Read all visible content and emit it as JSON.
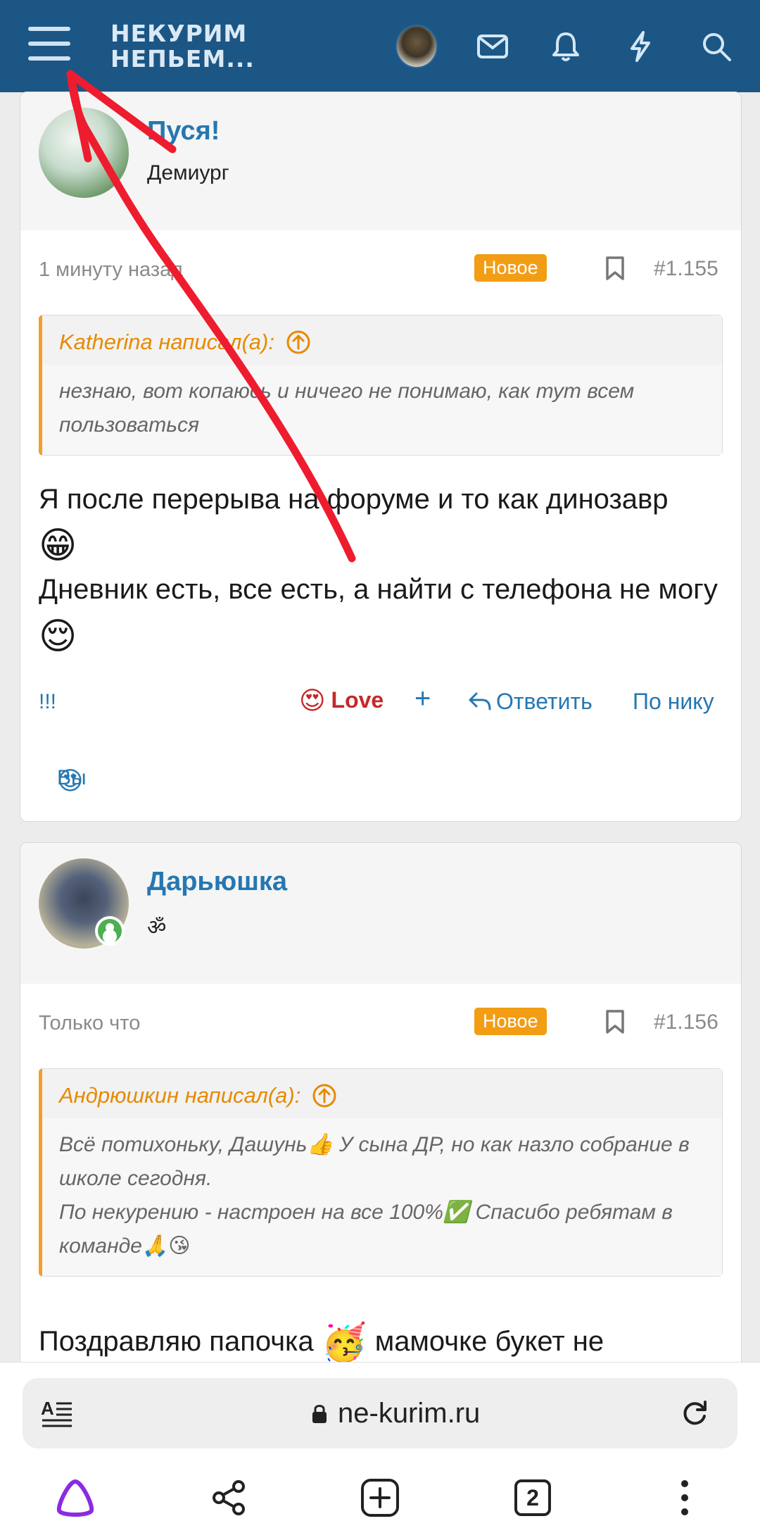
{
  "header": {
    "logo_line1": "НЕКУРИМ",
    "logo_line2": "НЕПЬЕМ...",
    "icons": [
      "menu-icon",
      "avatar",
      "mail-icon",
      "bell-icon",
      "bolt-icon",
      "search-icon"
    ]
  },
  "posts": [
    {
      "author": "Пуся!",
      "title": "Демиург",
      "time": "1 минуту назад",
      "badge": "Новое",
      "number": "#1.155",
      "quote_author": "Katherina написал(а):",
      "quote_text": "незнаю, вот копаюсь и ничего не понимаю, как тут всем пользоваться",
      "message_line1": "Я после перерыва на форуме и то как динозавр",
      "message_line2": "Дневник есть, все есть, а найти с телефона не могу",
      "action_left": "!!!",
      "reaction_label": "Love",
      "reply_label": "Ответить",
      "nick_label": "По нику",
      "reacted_by": "Вы"
    },
    {
      "author": "Дарьюшка",
      "title": "ॐ",
      "time": "Только что",
      "badge": "Новое",
      "number": "#1.156",
      "quote_author": "Андрюшкин написал(а):",
      "quote_line1": "Всё потихоньку, Дашунь👍 У сына ДР, но как назло собрание в школе сегодня.",
      "quote_line2": "По некурению - настроен на все 100%✅ Спасибо ребятам в команде🙏😘",
      "message_line1": "Поздравляю папочка",
      "message_line1b": "мамочке букет не"
    }
  ],
  "browser": {
    "url": "ne-kurim.ru",
    "tab_count": "2"
  },
  "colors": {
    "header_bg": "#1b5685",
    "link": "#2577b1",
    "badge": "#f29d13",
    "quote_accent": "#f0a02a",
    "annotation": "#ee1c2e"
  }
}
